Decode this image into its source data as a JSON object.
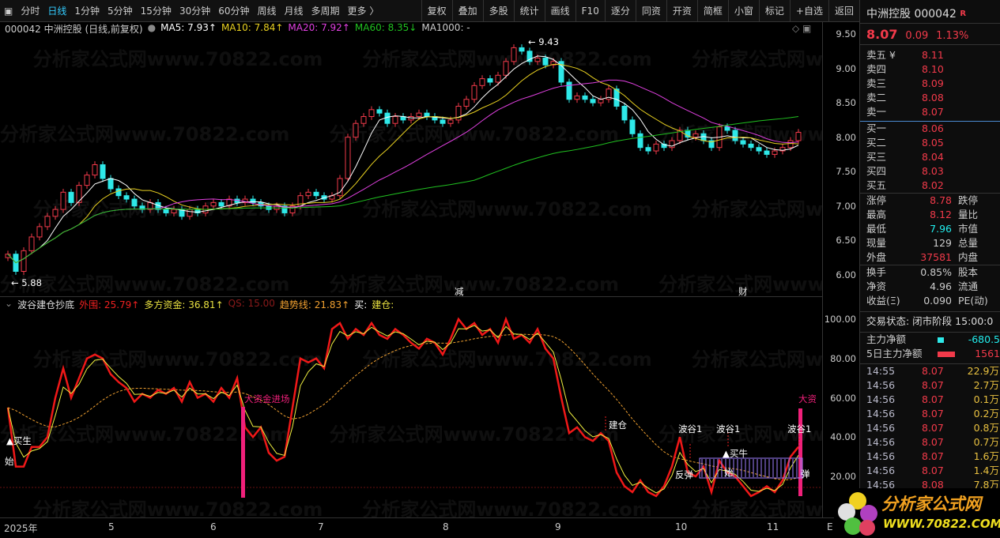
{
  "toolbar": {
    "periods": [
      "分时",
      "日线",
      "1分钟",
      "5分钟",
      "15分钟",
      "30分钟",
      "60分钟",
      "周线",
      "月线",
      "多周期",
      "更多 〉"
    ],
    "active": "日线",
    "buttons": [
      "复权",
      "叠加",
      "多股",
      "统计",
      "画线",
      "F10",
      "逐分",
      "同资",
      "开资",
      "简框",
      "小窗",
      "标记",
      "+自选",
      "返回"
    ]
  },
  "info": {
    "title": "000042 中洲控股 (日线,前复权)",
    "ma5": "MA5: 7.93↑",
    "ma10": "MA10: 7.84↑",
    "ma20": "MA20: 7.92↑",
    "ma60": "MA60: 8.35↓",
    "ma1000": "MA1000: -",
    "colors": {
      "ma5": "#ffffff",
      "ma10": "#e8d020",
      "ma20": "#e040e0",
      "ma60": "#20c020",
      "up": "#f23a4a",
      "down": "#2ee8e8"
    }
  },
  "indicator": {
    "name": "波谷建仓抄底",
    "waiwei": "外围: 25.79↑",
    "duofang": "多方资金: 36.81↑",
    "qs": "QS: 15.00",
    "trend": "趋势线: 21.83↑",
    "buy": "买:",
    "jiancang": "建仓:"
  },
  "price_axis": [
    "9.50",
    "9.00",
    "8.50",
    "8.00",
    "7.50",
    "7.00",
    "6.50",
    "6.00"
  ],
  "ind_axis": [
    "100.00",
    "80.00",
    "60.00",
    "40.00",
    "20.00"
  ],
  "x_axis": [
    "2025年",
    "5",
    "6",
    "7",
    "8",
    "9",
    "10",
    "11",
    "E"
  ],
  "markers": {
    "high": "9.43",
    "low": "5.88",
    "jian": "减",
    "cai": "财"
  },
  "annotations": {
    "big_in": "大资金进场",
    "big_in2": "大资",
    "buy_start": "▲买生",
    "start": "始",
    "build": "建仓",
    "trough": "波谷1",
    "rebound": "反弹",
    "buy_bull": "▲买牛",
    "start2": "始",
    "rebound2": "弹"
  },
  "chart_data": {
    "type": "candlestick",
    "ylim": [
      5.8,
      9.55
    ],
    "close": [
      6.3,
      6.05,
      6.35,
      6.55,
      6.7,
      6.85,
      6.95,
      7.2,
      7.05,
      7.3,
      7.45,
      7.6,
      7.4,
      7.25,
      7.15,
      7.1,
      7.0,
      6.95,
      7.05,
      6.95,
      6.9,
      6.95,
      6.85,
      6.95,
      6.9,
      7.0,
      7.05,
      7.0,
      7.1,
      7.05,
      7.1,
      7.05,
      7.0,
      6.95,
      7.0,
      6.9,
      7.0,
      7.15,
      7.2,
      7.15,
      7.1,
      7.15,
      7.4,
      8.0,
      8.2,
      8.3,
      8.4,
      8.35,
      8.2,
      8.3,
      8.25,
      8.3,
      8.35,
      8.3,
      8.25,
      8.2,
      8.25,
      8.45,
      8.55,
      8.75,
      8.85,
      8.8,
      8.9,
      9.1,
      9.3,
      9.25,
      9.1,
      9.15,
      9.05,
      9.1,
      8.8,
      8.55,
      8.6,
      8.55,
      8.5,
      8.55,
      8.7,
      8.45,
      8.25,
      8.05,
      7.85,
      7.8,
      7.9,
      7.85,
      7.95,
      8.1,
      8.0,
      8.05,
      7.95,
      7.85,
      8.15,
      8.1,
      7.95,
      7.9,
      7.85,
      7.8,
      7.75,
      7.8,
      7.85,
      7.95,
      8.07
    ],
    "indicator": {
      "ylim": [
        5,
        105
      ],
      "waiwei": [
        55,
        25,
        25,
        35,
        35,
        40,
        60,
        75,
        60,
        70,
        80,
        82,
        80,
        72,
        68,
        65,
        58,
        62,
        60,
        64,
        62,
        65,
        58,
        68,
        60,
        62,
        58,
        65,
        60,
        70,
        45,
        40,
        45,
        32,
        28,
        30,
        55,
        80,
        78,
        80,
        75,
        95,
        98,
        90,
        95,
        92,
        98,
        92,
        90,
        95,
        92,
        88,
        85,
        90,
        88,
        82,
        90,
        100,
        95,
        98,
        92,
        95,
        88,
        100,
        90,
        92,
        88,
        95,
        85,
        80,
        60,
        42,
        45,
        40,
        38,
        42,
        38,
        22,
        15,
        12,
        18,
        12,
        10,
        15,
        25,
        40,
        22,
        20,
        25,
        12,
        28,
        22,
        20,
        15,
        10,
        12,
        15,
        12,
        18,
        30,
        35
      ],
      "qs": 15
    }
  },
  "side": {
    "name": "中洲控股 000042",
    "badge": "R",
    "price": "8.07",
    "chg": "0.09",
    "pct": "1.13%",
    "asks": [
      [
        "卖五 ¥",
        "8.11"
      ],
      [
        "卖四",
        "8.10"
      ],
      [
        "卖三",
        "8.09"
      ],
      [
        "卖二",
        "8.08"
      ],
      [
        "卖一",
        "8.07"
      ]
    ],
    "bids": [
      [
        "买一",
        "8.06"
      ],
      [
        "买二",
        "8.05"
      ],
      [
        "买三",
        "8.04"
      ],
      [
        "买四",
        "8.03"
      ],
      [
        "买五",
        "8.02"
      ]
    ],
    "stats": [
      [
        "涨停",
        "8.78",
        "red",
        "跌停"
      ],
      [
        "最高",
        "8.12",
        "red",
        "量比"
      ],
      [
        "最低",
        "7.96",
        "cy",
        "市值"
      ],
      [
        "现量",
        "129",
        "",
        "总量"
      ],
      [
        "外盘",
        "37581",
        "red",
        "内盘"
      ]
    ],
    "stats2": [
      [
        "换手",
        "0.85%",
        "股本"
      ],
      [
        "净资",
        "4.96",
        "流通"
      ],
      [
        "收益(Ξ)",
        "0.090",
        "PE(动)"
      ]
    ],
    "status": "交易状态: 闭市阶段 15:00:0",
    "flow": [
      [
        "主力净额",
        "-680.5",
        "cy"
      ],
      [
        "5日主力净额",
        "1561",
        "red"
      ]
    ],
    "ticks": [
      [
        "14:55",
        "8.07",
        "22.9万"
      ],
      [
        "14:56",
        "8.07",
        "2.7万"
      ],
      [
        "14:56",
        "8.07",
        "0.1万"
      ],
      [
        "14:56",
        "8.07",
        "0.2万"
      ],
      [
        "14:56",
        "8.07",
        "0.8万"
      ],
      [
        "14:56",
        "8.07",
        "0.7万"
      ],
      [
        "14:56",
        "8.07",
        "1.6万"
      ],
      [
        "14:56",
        "8.07",
        "1.4万"
      ],
      [
        "14:56",
        "8.08",
        "7.8万"
      ]
    ]
  },
  "logo": {
    "name": "分析家公式网",
    "url": "www.70822.com"
  },
  "watermark": "分析家公式网www.70822.com"
}
